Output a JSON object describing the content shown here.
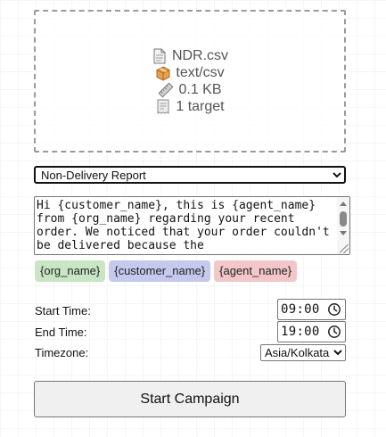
{
  "file": {
    "name": "NDR.csv",
    "type": "text/csv",
    "size": "0.1 KB",
    "targets": "1 target",
    "icons": [
      "file-icon",
      "package-icon",
      "ruler-icon",
      "receipt-icon"
    ]
  },
  "template_select": {
    "selected": "Non-Delivery Report"
  },
  "message": {
    "text": "Hi {customer_name}, this is {agent_name} from {org_name} regarding your recent order. We noticed that your order couldn't be delivered because the"
  },
  "variables": [
    {
      "label": "{org_name}",
      "color": "#c8e6c4"
    },
    {
      "label": "{customer_name}",
      "color": "#c5c9ee"
    },
    {
      "label": "{agent_name}",
      "color": "#f3c6c9"
    }
  ],
  "schedule": {
    "start_label": "Start Time:",
    "start_value": "09:00",
    "end_label": "End Time:",
    "end_value": "19:00",
    "tz_label": "Timezone:",
    "tz_value": "Asia/Kolkata"
  },
  "actions": {
    "start_label": "Start Campaign"
  }
}
